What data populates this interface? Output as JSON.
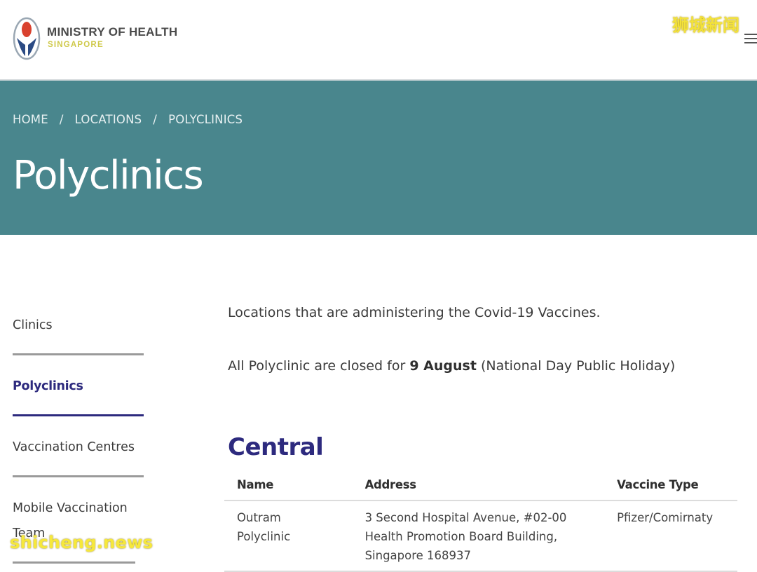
{
  "header": {
    "org_name": "MINISTRY OF HEALTH",
    "org_sub": "SINGAPORE",
    "watermark": "狮城新闻"
  },
  "breadcrumb": [
    "HOME",
    "LOCATIONS",
    "POLYCLINICS"
  ],
  "breadcrumb_separator": "/",
  "page_title": "Polyclinics",
  "sidebar": {
    "items": [
      {
        "label": "Clinics",
        "active": false
      },
      {
        "label": "Polyclinics",
        "active": true
      },
      {
        "label": "Vaccination Centres",
        "active": false
      },
      {
        "label": "Mobile Vaccination Team",
        "active": false
      }
    ]
  },
  "content": {
    "intro": "Locations that are administering the Covid-19 Vaccines.",
    "notice_prefix": "All Polyclinic are closed for ",
    "notice_bold": "9 August",
    "notice_suffix": " (National Day Public Holiday)",
    "region": "Central",
    "table": {
      "headers": [
        "Name",
        "Address",
        "Vaccine Type"
      ],
      "rows": [
        [
          "Outram Polyclinic",
          "3 Second Hospital Avenue, #02-00 Health Promotion Board Building, Singapore 168937",
          "Pfizer/Comirnaty"
        ]
      ]
    }
  },
  "footer_watermark": "shicheng.news",
  "colors": {
    "banner": "#49868d",
    "accent": "#2d2a7e",
    "logo_red": "#d9412e",
    "logo_blue": "#2b4b84"
  }
}
